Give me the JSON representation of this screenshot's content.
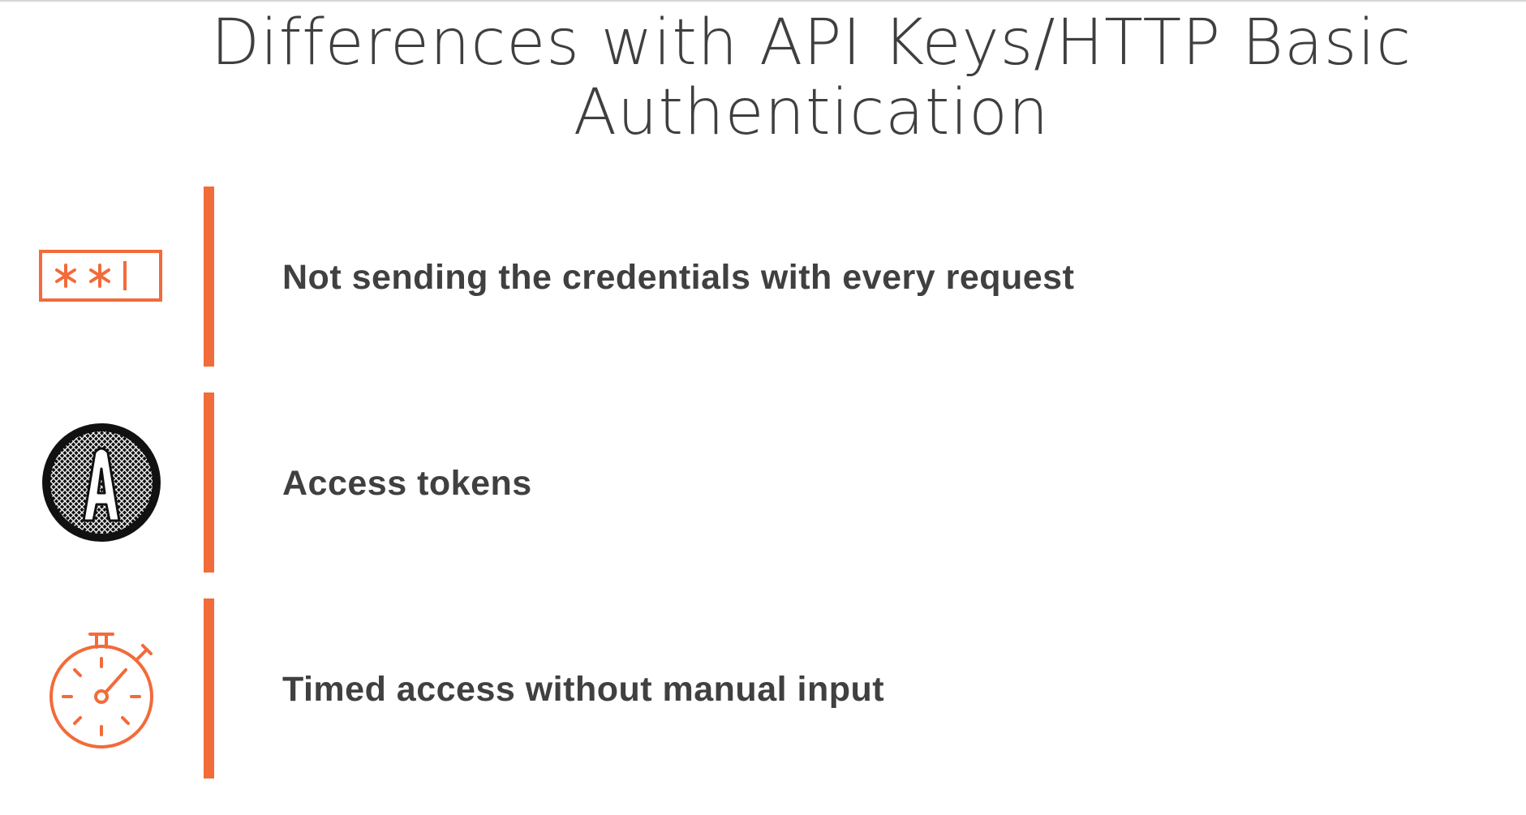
{
  "title": {
    "line1": "Differences with API Keys/HTTP Basic",
    "line2": "Authentication"
  },
  "accent_color": "#f26b3a",
  "text_color": "#404040",
  "items": [
    {
      "icon": "password-field-icon",
      "label": "Not sending the credentials with every request"
    },
    {
      "icon": "access-token-badge-icon",
      "label": "Access tokens"
    },
    {
      "icon": "stopwatch-icon",
      "label": "Timed access without manual input"
    }
  ]
}
